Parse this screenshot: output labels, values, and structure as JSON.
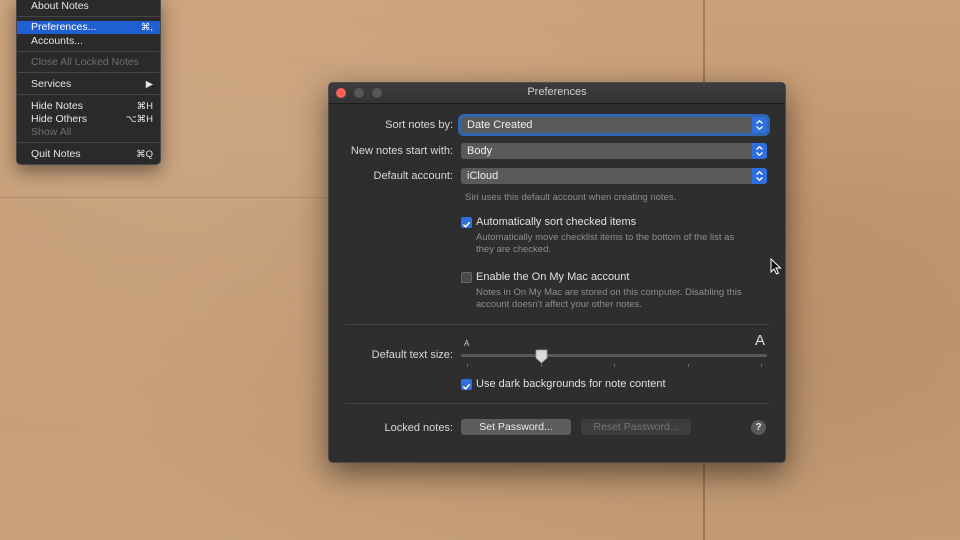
{
  "app_menu": {
    "items": [
      {
        "label": "About Notes",
        "shortcut": "",
        "state": "normal"
      },
      {
        "label": "Preferences...",
        "shortcut": "⌘,",
        "state": "selected"
      },
      {
        "label": "Accounts...",
        "shortcut": "",
        "state": "normal"
      },
      {
        "label": "Close All Locked Notes",
        "shortcut": "",
        "state": "disabled"
      },
      {
        "label": "Services",
        "shortcut": "▶",
        "state": "normal"
      },
      {
        "label": "Hide Notes",
        "shortcut": "⌘H",
        "state": "normal"
      },
      {
        "label": "Hide Others",
        "shortcut": "⌥⌘H",
        "state": "normal"
      },
      {
        "label": "Show All",
        "shortcut": "",
        "state": "disabled"
      },
      {
        "label": "Quit Notes",
        "shortcut": "⌘Q",
        "state": "normal"
      }
    ]
  },
  "window": {
    "title": "Preferences",
    "sort_label": "Sort notes by:",
    "sort_value": "Date Created",
    "new_notes_label": "New notes start with:",
    "new_notes_value": "Body",
    "account_label": "Default account:",
    "account_value": "iCloud",
    "account_hint": "Siri uses this default account when creating notes.",
    "auto_sort_label": "Automatically sort checked items",
    "auto_sort_checked": true,
    "auto_sort_hint_1": "Automatically move checklist items to the bottom of the list as",
    "auto_sort_hint_2": "they are checked.",
    "onmymac_label": "Enable the On My Mac account",
    "onmymac_checked": false,
    "onmymac_hint_1": "Notes in On My Mac are stored on this computer. Disabling this",
    "onmymac_hint_2": "account doesn't affect your other notes.",
    "text_size_label": "Default text size:",
    "text_size_small": "A",
    "text_size_large": "A",
    "text_size_level": 0.26,
    "dark_bg_label": "Use dark backgrounds for note content",
    "dark_bg_checked": true,
    "locked_label": "Locked notes:",
    "set_password": "Set Password...",
    "reset_password": "Reset Password...",
    "help": "?"
  },
  "colors": {
    "accent": "#2f6fe0",
    "menu_selection": "#1f5fd1",
    "close_button": "#fc5f57"
  }
}
